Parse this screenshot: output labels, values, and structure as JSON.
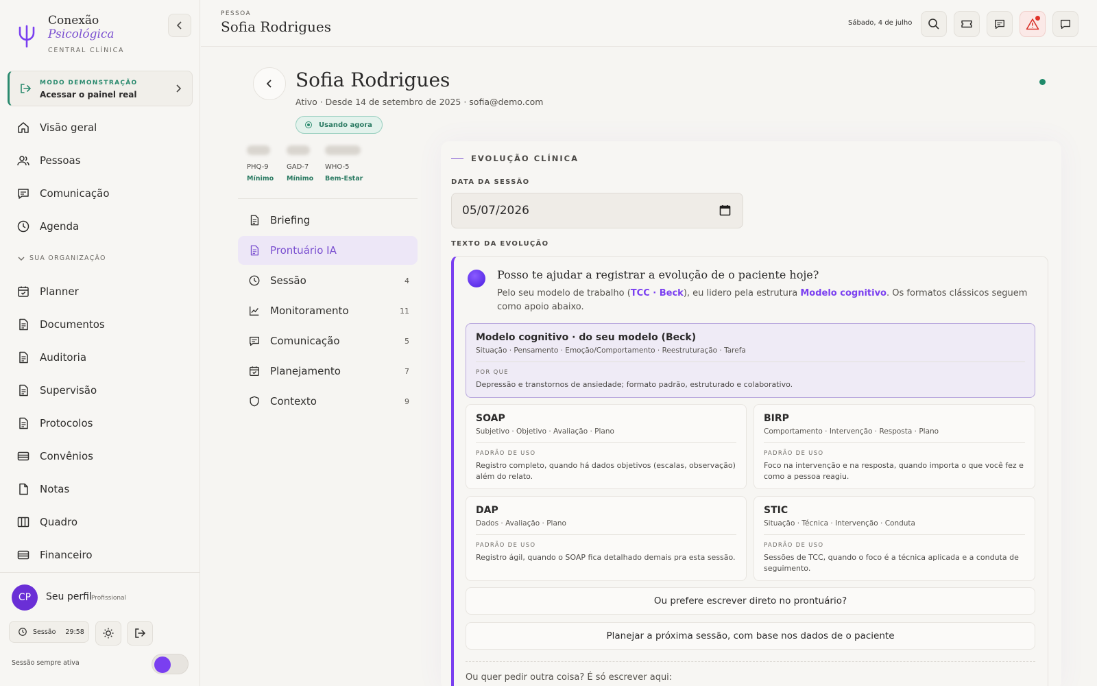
{
  "brand": {
    "line1": "Conexão",
    "line2": "Psicológica",
    "line3": "CENTRAL CLÍNICA",
    "accent": "#7a4fd0"
  },
  "demo": {
    "kicker": "MODO DEMONSTRAÇÃO",
    "action": "Acessar o painel real"
  },
  "nav": [
    {
      "label": "Visão geral",
      "icon": "home-icon"
    },
    {
      "label": "Pessoas",
      "icon": "users-icon"
    },
    {
      "label": "Comunicação",
      "icon": "chat-icon"
    },
    {
      "label": "Agenda",
      "icon": "clock-icon"
    }
  ],
  "org_section": "SUA ORGANIZAÇÃO",
  "org_nav": [
    {
      "label": "Planner",
      "icon": "calendar-check-icon"
    },
    {
      "label": "Documentos",
      "icon": "document-icon"
    },
    {
      "label": "Auditoria",
      "icon": "document-icon"
    },
    {
      "label": "Supervisão",
      "icon": "document-icon"
    },
    {
      "label": "Protocolos",
      "icon": "document-icon"
    },
    {
      "label": "Convênios",
      "icon": "card-icon"
    },
    {
      "label": "Notas",
      "icon": "file-icon"
    },
    {
      "label": "Quadro",
      "icon": "columns-icon"
    },
    {
      "label": "Financeiro",
      "icon": "card-icon"
    }
  ],
  "profile": {
    "initials": "CP",
    "name": "Seu perfil",
    "role": "Profissional"
  },
  "session": {
    "label": "Sessão",
    "timer": "29:58",
    "always_active": "Sessão sempre ativa"
  },
  "topbar": {
    "kicker": "PESSOA",
    "name": "Sofia Rodrigues",
    "date": "Sábado, 4 de julho"
  },
  "patient": {
    "name": "Sofia Rodrigues",
    "meta": "Ativo · Desde 14 de setembro de 2025 · sofia@demo.com",
    "badge": "Usando agora"
  },
  "scores": [
    {
      "name": "PHQ-9",
      "status": "Mínimo"
    },
    {
      "name": "GAD-7",
      "status": "Mínimo"
    },
    {
      "name": "WHO-5",
      "status": "Bem-Estar"
    }
  ],
  "patient_nav": [
    {
      "label": "Briefing",
      "count": "",
      "icon": "document-icon"
    },
    {
      "label": "Prontuário IA",
      "count": "",
      "icon": "document-icon"
    },
    {
      "label": "Sessão",
      "count": "4",
      "icon": "clock-icon"
    },
    {
      "label": "Monitoramento",
      "count": "11",
      "icon": "chart-icon"
    },
    {
      "label": "Comunicação",
      "count": "5",
      "icon": "chat-icon"
    },
    {
      "label": "Planejamento",
      "count": "7",
      "icon": "calendar-check-icon"
    },
    {
      "label": "Contexto",
      "count": "9",
      "icon": "shield-icon"
    }
  ],
  "evolution": {
    "title": "EVOLUÇÃO CLÍNICA",
    "date_label": "DATA DA SESSÃO",
    "date_value": "05/07/2026",
    "text_label": "TEXTO DA EVOLUÇÃO",
    "question": "Posso te ajudar a registrar a evolução de o paciente hoje?",
    "desc_1": "Pelo seu modelo de trabalho (",
    "desc_hl1": "TCC · Beck",
    "desc_2": "), eu lidero pela estrutura ",
    "desc_hl2": "Modelo cognitivo",
    "desc_3": ". Os formatos clássicos seguem como apoio abaixo.",
    "featured": {
      "title": "Modelo cognitivo · do seu modelo (Beck)",
      "sub": "Situação · Pensamento · Emoção/Comportamento · Reestruturação · Tarefa",
      "key": "POR QUE",
      "desc": "Depressão e transtornos de ansiedade; formato padrão, estruturado e colaborativo."
    },
    "formats": [
      {
        "title": "SOAP",
        "sub": "Subjetivo · Objetivo · Avaliação · Plano",
        "key": "PADRÃO DE USO",
        "desc": "Registro completo, quando há dados objetivos (escalas, observação) além do relato."
      },
      {
        "title": "BIRP",
        "sub": "Comportamento · Intervenção · Resposta · Plano",
        "key": "PADRÃO DE USO",
        "desc": "Foco na intervenção e na resposta, quando importa o que você fez e como a pessoa reagiu."
      },
      {
        "title": "DAP",
        "sub": "Dados · Avaliação · Plano",
        "key": "PADRÃO DE USO",
        "desc": "Registro ágil, quando o SOAP fica detalhado demais pra esta sessão."
      },
      {
        "title": "STIC",
        "sub": "Situação · Técnica · Intervenção · Conduta",
        "key": "PADRÃO DE USO",
        "desc": "Sessões de TCC, quando o foco é a técnica aplicada e a conduta de seguimento."
      }
    ],
    "option_write": "Ou prefere escrever direto no prontuário?",
    "option_plan": "Planejar a próxima sessão, com base nos dados de o paciente",
    "other": "Ou quer pedir outra coisa? É só escrever aqui:"
  }
}
